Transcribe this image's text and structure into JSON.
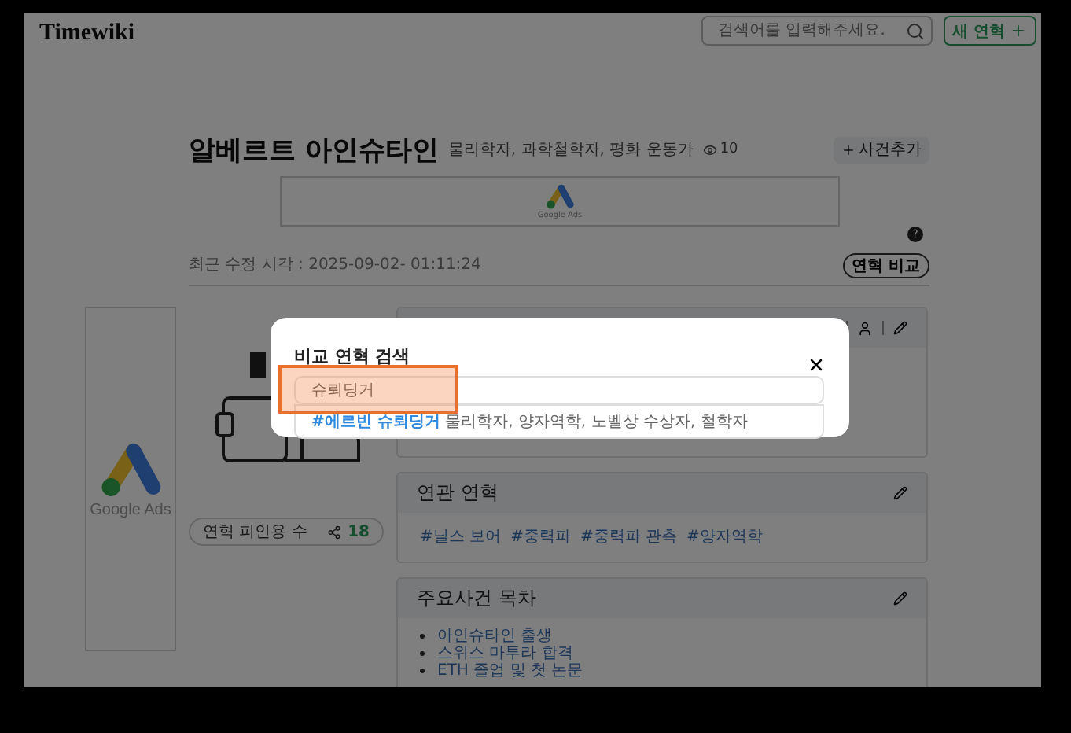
{
  "header": {
    "logo": "Timewiki",
    "search": {
      "placeholder": "검색어를 입력해주세요."
    },
    "new_button": "새 연혁"
  },
  "profile": {
    "title": "알베르트 아인슈타인",
    "subtitle": "물리학자, 과학철학자, 평화 운동가",
    "views": "10",
    "add_event_button": "사건추가",
    "help_badge": "?",
    "last_modified": "최근 수정 시각 : 2025-09-02- 01:11:24",
    "compare_button": "연혁 비교"
  },
  "banner_ad": {
    "label": "Google Ads"
  },
  "side_ad": {
    "label": "Google Ads"
  },
  "citations": {
    "label": "연혁 피인용 수",
    "count": "18"
  },
  "panels": [
    {
      "kind": "summary"
    },
    {
      "kind": "tags",
      "title": "연관 연혁",
      "tags": [
        "#닐스 보어",
        "#중력파",
        "#중력파 관측",
        "#양자역학"
      ]
    },
    {
      "kind": "list",
      "title": "주요사건 목차",
      "items": [
        "아인슈타인 출생",
        "스위스 마투라 합격",
        "ETH 졸업 및 첫 논문"
      ]
    }
  ],
  "modal": {
    "title": "비교 연혁 검색",
    "query": "슈뢰딩거",
    "results": [
      {
        "name": "#에르빈 슈뢰딩거",
        "description": "물리학자, 양자역학, 노벨상 수상자, 철학자"
      }
    ]
  }
}
